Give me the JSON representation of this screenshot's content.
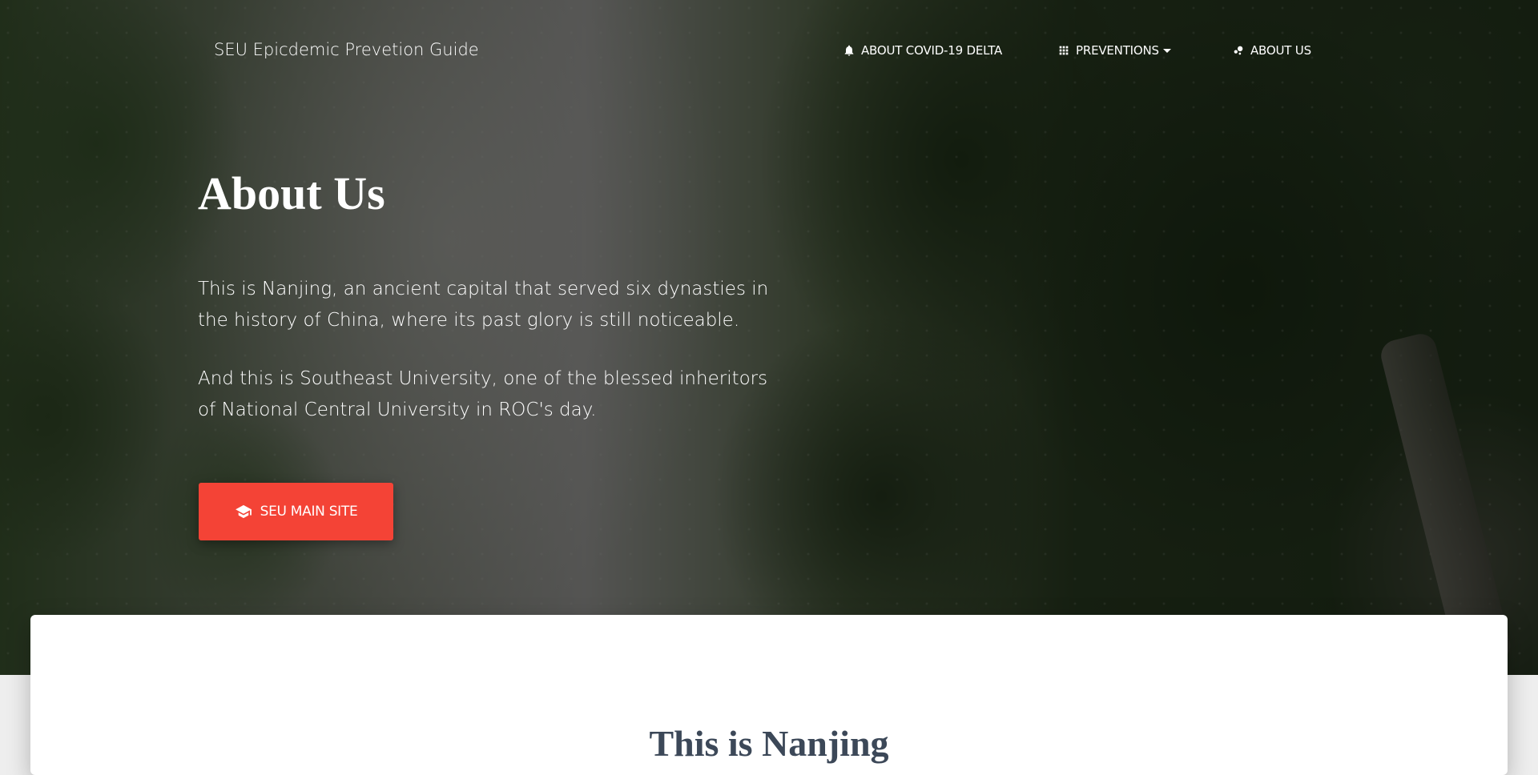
{
  "navbar": {
    "brand": "SEU Epicdemic Prevetion Guide",
    "items": [
      {
        "label": "ABOUT COVID-19 DELTA",
        "icon": "bell-icon"
      },
      {
        "label": "PREVENTIONS",
        "icon": "apps-grid-icon",
        "dropdown": true
      },
      {
        "label": "ABOUT US",
        "icon": "bubble-chart-icon"
      }
    ]
  },
  "hero": {
    "title": "About Us",
    "paragraphs": [
      "This is Nanjing, an ancient capital that served six dynasties in the history of China, where its past glory is still noticeable.",
      "And this is Southeast University, one of the blessed inheritors of National Central University in ROC's day."
    ],
    "cta": {
      "label": "SEU MAIN SITE",
      "icon": "school-icon"
    }
  },
  "card": {
    "title": "This is Nanjing"
  },
  "colors": {
    "accent": "#f44336",
    "card_title": "#3c4858",
    "page_background": "#eeeeee"
  }
}
